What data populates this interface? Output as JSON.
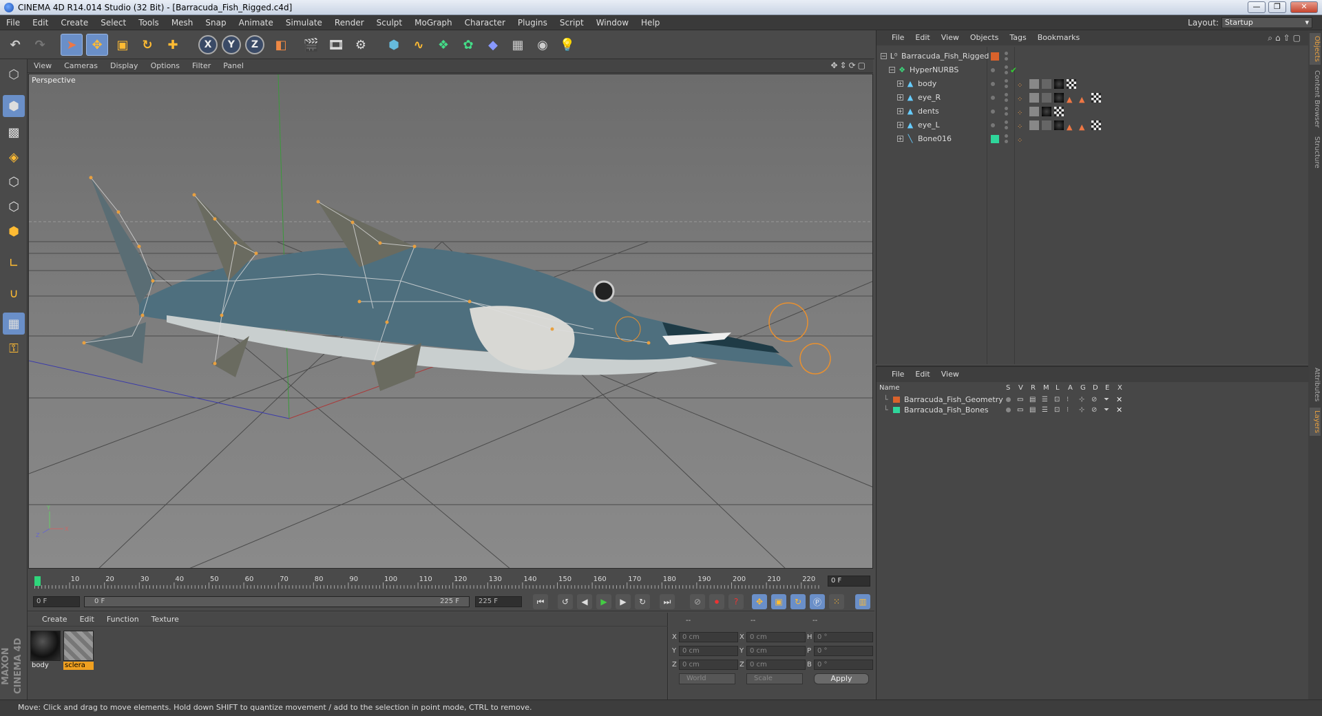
{
  "window": {
    "title": "CINEMA 4D R14.014 Studio (32 Bit) - [Barracuda_Fish_Rigged.c4d]",
    "buttons": [
      "—",
      "❐",
      "✕"
    ]
  },
  "menubar": {
    "items": [
      "File",
      "Edit",
      "Create",
      "Select",
      "Tools",
      "Mesh",
      "Snap",
      "Animate",
      "Simulate",
      "Render",
      "Sculpt",
      "MoGraph",
      "Character",
      "Plugins",
      "Script",
      "Window",
      "Help"
    ],
    "layout_label": "Layout:",
    "layout_value": "Startup"
  },
  "toolbar": {
    "axis_labels": [
      "X",
      "Y",
      "Z"
    ]
  },
  "viewport": {
    "menu": [
      "View",
      "Cameras",
      "Display",
      "Options",
      "Filter",
      "Panel"
    ],
    "label": "Perspective",
    "axis_y": "Y",
    "axis_x": "X",
    "axis_z": "Z"
  },
  "timeline": {
    "ticks": [
      "0",
      "10",
      "20",
      "30",
      "40",
      "50",
      "60",
      "70",
      "80",
      "90",
      "100",
      "110",
      "120",
      "130",
      "140",
      "150",
      "160",
      "170",
      "180",
      "190",
      "200",
      "210",
      "220"
    ],
    "current_frame": "0 F",
    "start_field": "0 F",
    "range_start": "0 F",
    "range_end": "225 F",
    "end_field": "225 F"
  },
  "material_panel": {
    "menu": [
      "Create",
      "Edit",
      "Function",
      "Texture"
    ],
    "materials": [
      {
        "name": "body",
        "selected": false
      },
      {
        "name": "sclera",
        "selected": true
      }
    ]
  },
  "coord_panel": {
    "headers": [
      "--",
      "--",
      "--"
    ],
    "rows": [
      {
        "a_label": "X",
        "a_val": "0 cm",
        "b_label": "X",
        "b_val": "0 cm",
        "c_label": "H",
        "c_val": "0 °"
      },
      {
        "a_label": "Y",
        "a_val": "0 cm",
        "b_label": "Y",
        "b_val": "0 cm",
        "c_label": "P",
        "c_val": "0 °"
      },
      {
        "a_label": "Z",
        "a_val": "0 cm",
        "b_label": "Z",
        "b_val": "0 cm",
        "c_label": "B",
        "c_val": "0 °"
      }
    ],
    "world_dropdown": "World",
    "scale_dropdown": "Scale",
    "apply_label": "Apply"
  },
  "status": {
    "text": "Move: Click and drag to move elements. Hold down SHIFT to quantize movement / add to the selection in point mode, CTRL to remove."
  },
  "object_manager": {
    "menu": [
      "File",
      "Edit",
      "View",
      "Objects",
      "Tags",
      "Bookmarks"
    ],
    "objects": [
      {
        "name": "Barracuda_Fish_Rigged",
        "depth": 0,
        "layer_color": "#d9622b"
      },
      {
        "name": "HyperNURBS",
        "depth": 1,
        "layer_color": ""
      },
      {
        "name": "body",
        "depth": 2,
        "layer_color": ""
      },
      {
        "name": "eye_R",
        "depth": 2,
        "layer_color": ""
      },
      {
        "name": "dents",
        "depth": 2,
        "layer_color": ""
      },
      {
        "name": "eye_L",
        "depth": 2,
        "layer_color": ""
      },
      {
        "name": "Bone016",
        "depth": 2,
        "layer_color": "#2fd69b"
      }
    ]
  },
  "side_tabs": [
    "Objects",
    "Content Browser",
    "Structure",
    "Attributes",
    "Layers"
  ],
  "layer_manager": {
    "menu": [
      "File",
      "Edit",
      "View"
    ],
    "columns": [
      "Name",
      "S",
      "V",
      "R",
      "M",
      "L",
      "A",
      "G",
      "D",
      "E",
      "X"
    ],
    "layers": [
      {
        "name": "Barracuda_Fish_Geometry",
        "color": "#d9622b"
      },
      {
        "name": "Barracuda_Fish_Bones",
        "color": "#2fd69b"
      }
    ]
  },
  "logo": "MAXON CINEMA 4D"
}
